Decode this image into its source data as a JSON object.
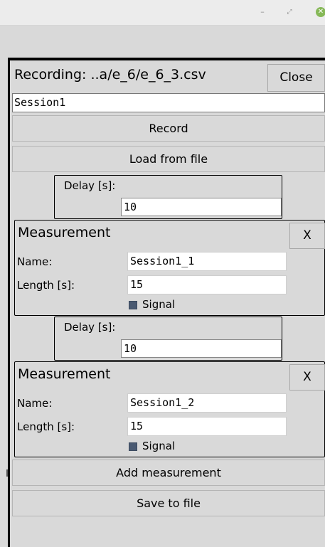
{
  "window": {
    "minimize": "–",
    "maximize": "⤢",
    "close": "✕"
  },
  "recording": {
    "label": "Recording: ..a/e_6/e_6_3.csv",
    "close_label": "Close"
  },
  "session": {
    "value": "Session1"
  },
  "buttons": {
    "record": "Record",
    "load": "Load from file",
    "add_measurement": "Add measurement",
    "save": "Save to file"
  },
  "steps": [
    {
      "delay_label": "Delay [s]:",
      "delay_value": "10",
      "measurement": {
        "title": "Measurement",
        "remove_label": "X",
        "name_label": "Name:",
        "name_value": "Session1_1",
        "length_label": "Length [s]:",
        "length_value": "15",
        "signal_label": "Signal",
        "signal_checked": true
      }
    },
    {
      "delay_label": "Delay [s]:",
      "delay_value": "10",
      "measurement": {
        "title": "Measurement",
        "remove_label": "X",
        "name_label": "Name:",
        "name_value": "Session1_2",
        "length_label": "Length [s]:",
        "length_value": "15",
        "signal_label": "Signal",
        "signal_checked": true
      }
    }
  ]
}
